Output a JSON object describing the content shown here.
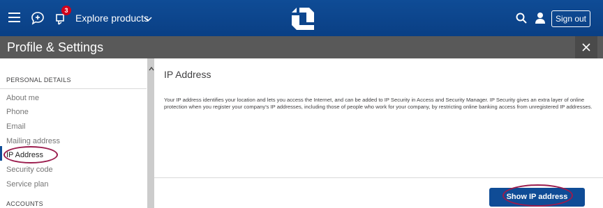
{
  "topbar": {
    "explore_label": "Explore products",
    "notification_count": "3",
    "signout_label": "Sign out"
  },
  "titlebar": {
    "title": "Profile & Settings"
  },
  "sidebar": {
    "section1": "PERSONAL DETAILS",
    "items": [
      {
        "label": "About me"
      },
      {
        "label": "Phone"
      },
      {
        "label": "Email"
      },
      {
        "label": "Mailing address"
      },
      {
        "label": "IP Address"
      },
      {
        "label": "Security code"
      },
      {
        "label": "Service plan"
      }
    ],
    "active_index": 4,
    "section2": "ACCOUNTS"
  },
  "main": {
    "title": "IP Address",
    "description": "Your IP address identifies your location and lets you access the Internet, and can be added to IP Security in Access and Security Manager. IP Security gives an extra layer of online protection when you register your company's IP addresses, including those of people who work for your company, by restricting online banking access from unregistered IP addresses.",
    "button_label": "Show IP address"
  },
  "colors": {
    "brand_blue": "#0f4c96",
    "title_bar": "#595959",
    "highlight": "#9b1c4d",
    "badge": "#d0021b"
  },
  "icons": [
    "hamburger-icon",
    "chat-icon",
    "notification-icon",
    "chevron-down-icon",
    "chase-logo-icon",
    "search-icon",
    "user-icon",
    "close-icon",
    "scroll-up-icon"
  ]
}
